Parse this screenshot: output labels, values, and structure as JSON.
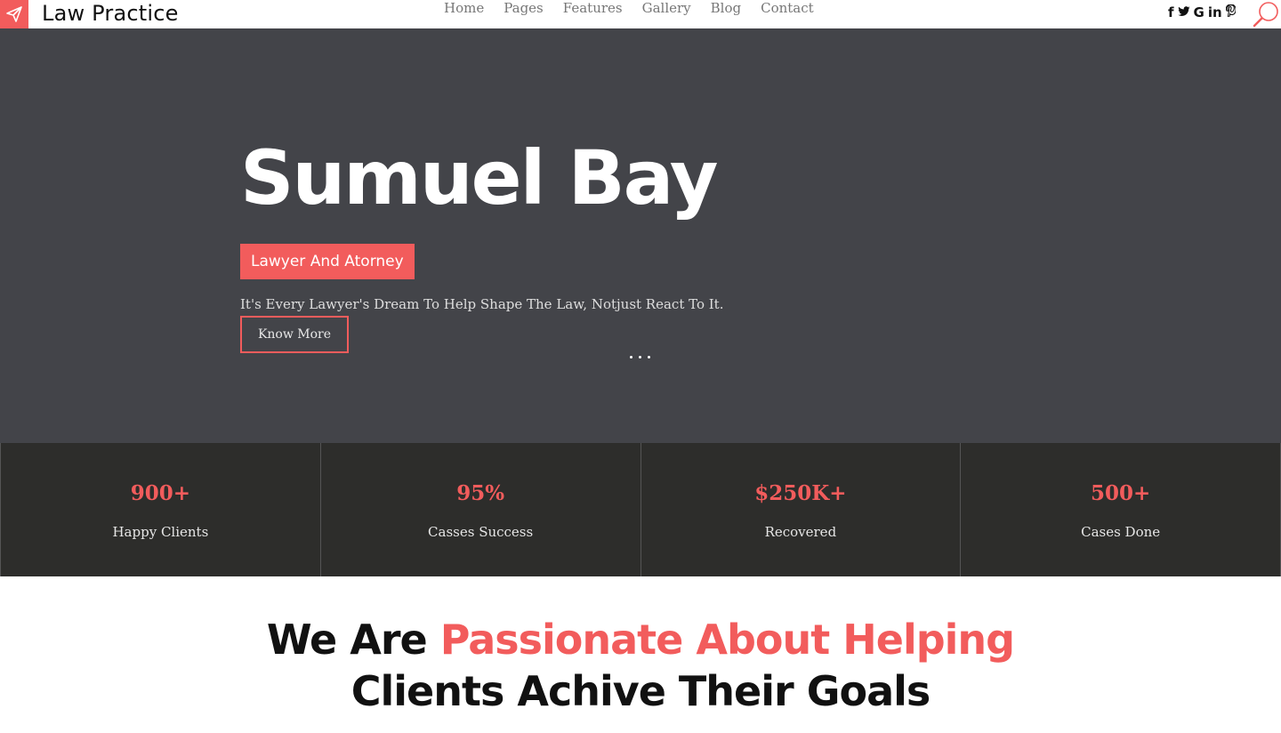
{
  "brand": {
    "name": "Law Practice",
    "logo_icon": "paper-plane-icon",
    "accent_color": "#f25c5c"
  },
  "nav": {
    "items": [
      {
        "label": "Home"
      },
      {
        "label": "Pages"
      },
      {
        "label": "Features"
      },
      {
        "label": "Gallery"
      },
      {
        "label": "Blog"
      },
      {
        "label": "Contact"
      }
    ]
  },
  "social": {
    "items": [
      {
        "icon": "facebook-icon",
        "glyph": "f"
      },
      {
        "icon": "twitter-icon",
        "glyph": "❦"
      },
      {
        "icon": "google-icon",
        "glyph": "G"
      },
      {
        "icon": "linkedin-icon",
        "glyph": "in"
      },
      {
        "icon": "pinterest-icon",
        "glyph": "℗"
      }
    ],
    "search_icon": "search-icon"
  },
  "hero": {
    "title": "Sumuel Bay",
    "badge": "Lawyer And Atorney",
    "tagline": "It's Every Lawyer's Dream To Help Shape The Law, Notjust React To It.",
    "button_label": "Know More",
    "background_color": "#434449"
  },
  "stats": [
    {
      "value": "900+",
      "label": "Happy Clients"
    },
    {
      "value": "95%",
      "label": "Casses Success"
    },
    {
      "value": "$250K+",
      "label": "Recovered"
    },
    {
      "value": "500+",
      "label": "Cases Done"
    }
  ],
  "headline": {
    "lead": "We Are ",
    "accent": "Passionate About Helping",
    "rest": "Clients Achive Their Goals"
  }
}
